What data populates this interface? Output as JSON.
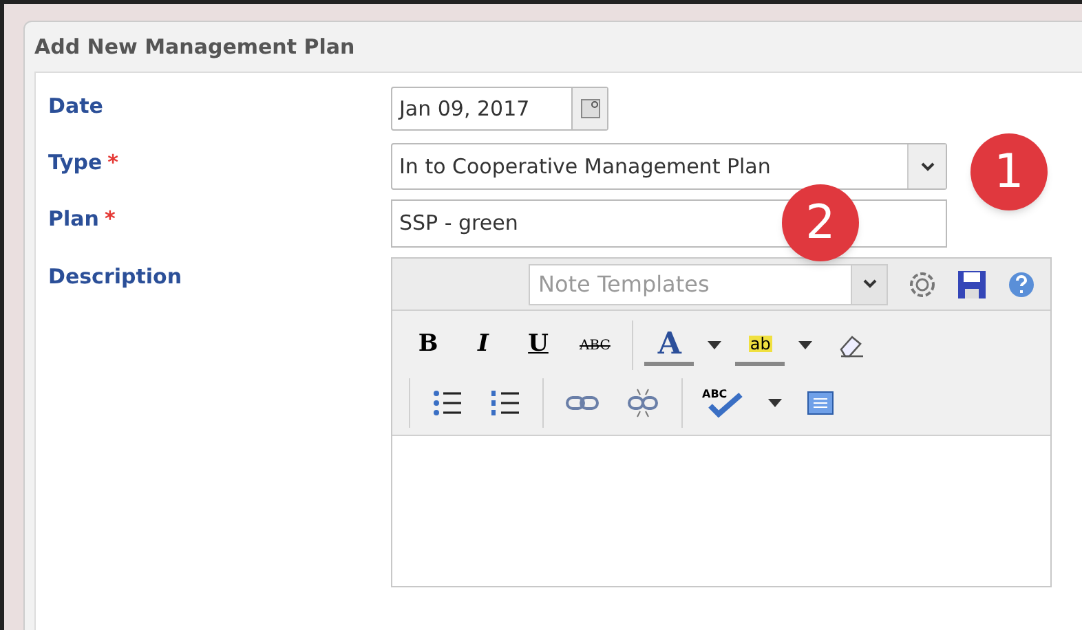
{
  "dialog": {
    "title": "Add New Management Plan"
  },
  "fields": [
    {
      "kind": "date",
      "label": "Date",
      "required": false,
      "value": "Jan 09, 2017"
    },
    {
      "kind": "select",
      "label": "Type",
      "required": true,
      "value": "In to Cooperative Management Plan"
    },
    {
      "kind": "text",
      "label": "Plan",
      "required": true,
      "value": "SSP - green"
    },
    {
      "kind": "editor",
      "label": "Description",
      "required": false
    }
  ],
  "required_mark": "*",
  "editor": {
    "template_placeholder": "Note Templates",
    "toolbar_rows": [
      [
        {
          "kind": "bold",
          "text": "B"
        },
        {
          "kind": "italic",
          "text": "I"
        },
        {
          "kind": "underline",
          "text": "U"
        },
        {
          "kind": "strike",
          "text": "ABC"
        },
        {
          "kind": "sep"
        },
        {
          "kind": "fontcolor",
          "text": "A"
        },
        {
          "kind": "caret"
        },
        {
          "kind": "highlight",
          "text": "ab"
        },
        {
          "kind": "caret"
        },
        {
          "kind": "eraser"
        }
      ],
      [
        {
          "kind": "sep"
        },
        {
          "kind": "bullets"
        },
        {
          "kind": "numbers"
        },
        {
          "kind": "sep"
        },
        {
          "kind": "link"
        },
        {
          "kind": "unlink"
        },
        {
          "kind": "sep"
        },
        {
          "kind": "spell",
          "text": "ABC"
        },
        {
          "kind": "caret"
        },
        {
          "kind": "source"
        }
      ]
    ]
  },
  "callouts": [
    {
      "text": "1"
    },
    {
      "text": "2"
    }
  ]
}
